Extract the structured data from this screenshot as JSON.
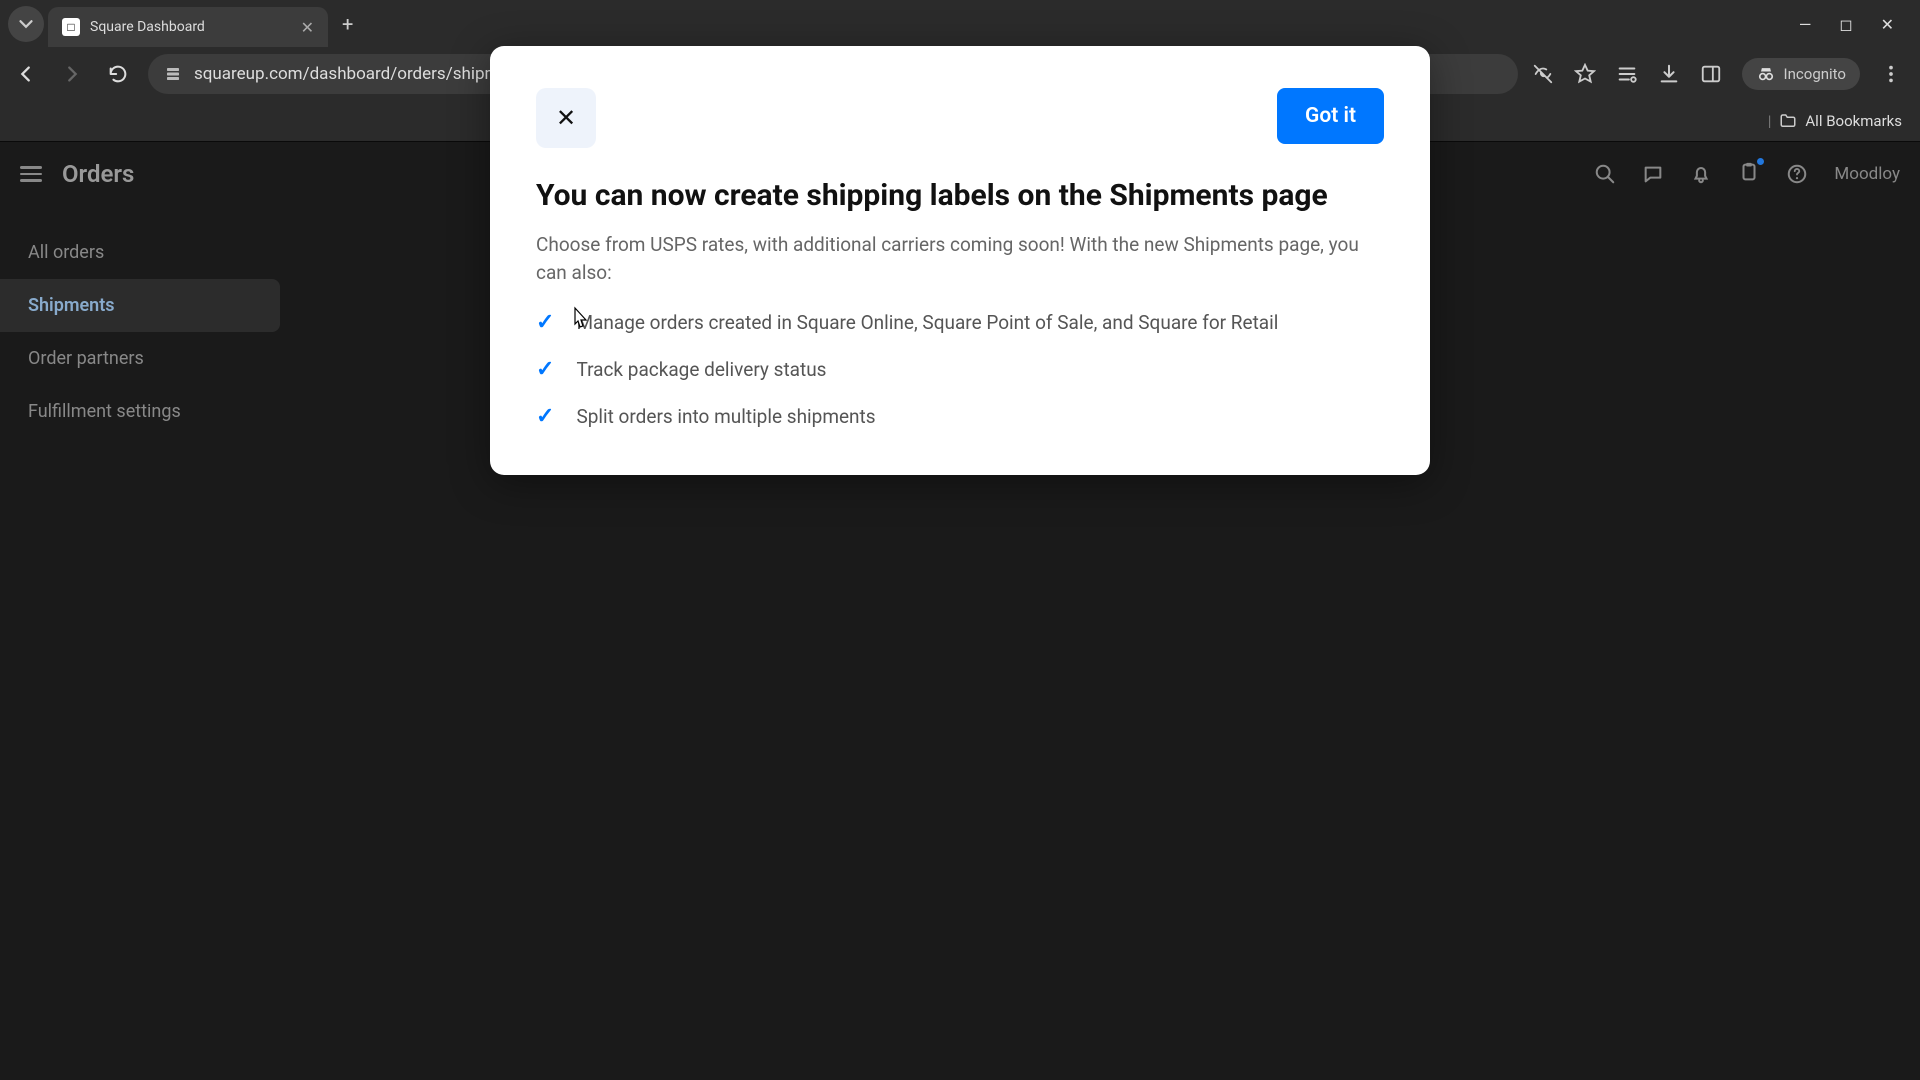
{
  "browser": {
    "tab_title": "Square Dashboard",
    "url": "squareup.com/dashboard/orders/shipments/to-do",
    "incognito_label": "Incognito",
    "bookmarks_label": "All Bookmarks"
  },
  "app": {
    "page_title": "Orders",
    "account_label": "Moodloy",
    "sidebar": {
      "items": [
        {
          "label": "All orders",
          "active": false
        },
        {
          "label": "Shipments",
          "active": true
        },
        {
          "label": "Order partners",
          "active": false
        },
        {
          "label": "Fulfillment settings",
          "active": false
        }
      ]
    }
  },
  "modal": {
    "close_label": "✕",
    "primary_button": "Got it",
    "title": "You can now create shipping labels on the Shipments page",
    "body": "Choose from USPS rates, with additional carriers coming soon! With the new Shipments page, you can also:",
    "bullets": [
      "Manage orders created in Square Online, Square Point of Sale, and Square for Retail",
      "Track package delivery status",
      "Split orders into multiple shipments"
    ]
  },
  "colors": {
    "accent": "#0077ff"
  }
}
